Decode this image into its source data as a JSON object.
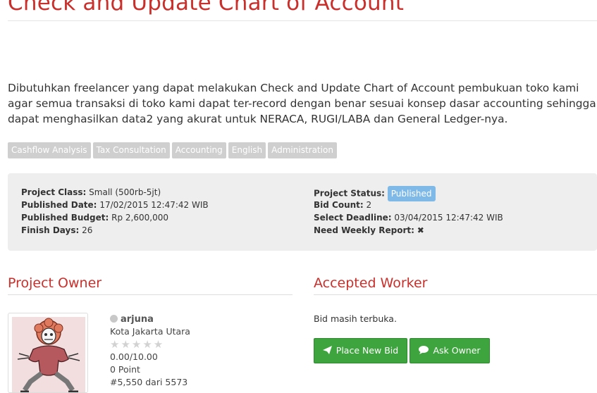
{
  "page": {
    "title": "Check and Update Chart of Account",
    "description": "Dibutuhkan freelancer yang dapat melakukan Check and Update Chart of Account pembukuan toko kami agar semua transaksi di toko kami dapat ter-record dengan benar sesuai konsep dasar accounting sehingga dapat menghasilkan data2 yang akurat untuk NERACA, RUGI/LABA dan General Ledger-nya."
  },
  "tags": [
    "Cashflow Analysis",
    "Tax Consultation",
    "Accounting",
    "English",
    "Administration"
  ],
  "info": {
    "left": [
      {
        "label": "Project Class:",
        "value": "Small (500rb-5jt)"
      },
      {
        "label": "Published Date:",
        "value": "17/02/2015 12:47:42 WIB"
      },
      {
        "label": "Published Budget:",
        "value": "Rp 2,600,000"
      },
      {
        "label": "Finish Days:",
        "value": "26"
      }
    ],
    "right": {
      "status_label": "Project Status:",
      "status_value": "Published",
      "bid_count_label": "Bid Count:",
      "bid_count_value": "2",
      "deadline_label": "Select Deadline:",
      "deadline_value": "03/04/2015 12:47:42 WIB",
      "weekly_label": "Need Weekly Report:",
      "weekly_value": "✖"
    }
  },
  "owner": {
    "section_title": "Project Owner",
    "username": "arjuna",
    "location": "Kota Jakarta Utara",
    "stars": "★★★★★",
    "rating": "0.00/10.00",
    "points": "0 Point",
    "rank": "#5,550 dari 5573"
  },
  "worker": {
    "section_title": "Accepted Worker",
    "status_text": "Bid masih terbuka.",
    "place_bid_label": "Place New Bid",
    "ask_owner_label": "Ask Owner"
  },
  "colors": {
    "accent_red": "#c9302c",
    "button_green": "#3ea43e",
    "badge_blue": "#7fb9e8",
    "tag_gray": "#cfcfcf",
    "panel_gray": "#eeeeee"
  },
  "icons": {
    "place_bid": "paper-plane-icon",
    "ask_owner": "chat-bubble-icon",
    "weekly_report": "close-icon",
    "online_status": "status-dot-icon"
  }
}
